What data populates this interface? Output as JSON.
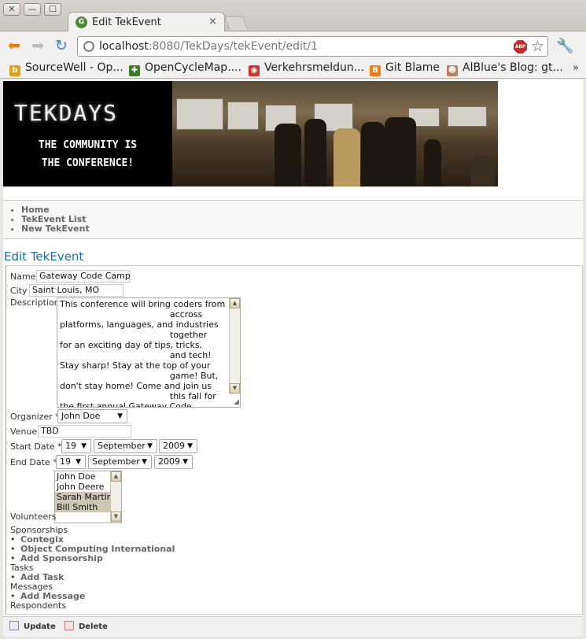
{
  "window": {
    "controls": [
      "✕",
      "—",
      "☐"
    ],
    "tab_title": "Edit TekEvent",
    "tab_close": "×"
  },
  "toolbar": {
    "back_icon": "back-arrow-icon",
    "forward_icon": "forward-arrow-icon",
    "reload_icon": "reload-icon",
    "url_host": "localhost",
    "url_rest": ":8080/TekDays/tekEvent/edit/1",
    "adblock_label": "ABP"
  },
  "bookmarks": {
    "items": [
      {
        "label": "SourceWell - Op...",
        "icon_char": "b",
        "color": "#e0a020"
      },
      {
        "label": "OpenCycleMap....",
        "icon_char": "✚",
        "color": "#3d7a2c"
      },
      {
        "label": "Verkehrsmeldun...",
        "icon_char": "◉",
        "color": "#d03030"
      },
      {
        "label": "Git Blame",
        "icon_char": "B",
        "color": "#f07d1f"
      },
      {
        "label": "AlBlue's Blog: gt...",
        "icon_char": "☻",
        "color": "#b88060"
      }
    ],
    "more": "»"
  },
  "banner": {
    "logo_text": "TEKDAYS",
    "tagline_1": "THE COMMUNITY IS",
    "tagline_2": "THE CONFERENCE!"
  },
  "nav": {
    "items": [
      "Home",
      "TekEvent List",
      "New TekEvent"
    ]
  },
  "page": {
    "title": "Edit TekEvent"
  },
  "form": {
    "name_label": "Name",
    "name_value": "Gateway Code Camp",
    "city_label": "City",
    "city_value": "Saint Louis, MO",
    "description_label": "Description",
    "description_value": "This conference will bring coders from\n                                        accross\nplatforms, languages, and industries\n                                        together\nfor an exciting day of tips, tricks,\n                                        and tech!\nStay sharp! Stay at the top of your\n                                        game! But,\ndon't stay home! Come and join us\n                                        this fall for\nthe first annual Gateway Code\n                                        Camp.",
    "organizer_label": "Organizer *",
    "organizer_value": "John Doe",
    "venue_label": "Venue",
    "venue_value": "TBD",
    "start_label": "Start Date *",
    "start_day": "19",
    "start_month": "September",
    "start_year": "2009",
    "end_label": "End Date *",
    "end_day": "19",
    "end_month": "September",
    "end_year": "2009",
    "volunteers_label": "Volunteers",
    "volunteers": [
      "John Doe",
      "John Deere",
      "Sarah Martin",
      "Bill Smith"
    ],
    "sponsorships_label": "Sponsorships",
    "sponsorships": [
      "Contegix",
      "Object Computing International"
    ],
    "add_sponsorship": "Add Sponsorship",
    "tasks_label": "Tasks",
    "add_task": "Add Task",
    "messages_label": "Messages",
    "add_message": "Add Message",
    "respondents_label": "Respondents"
  },
  "buttons": {
    "update": "Update",
    "delete": "Delete"
  }
}
